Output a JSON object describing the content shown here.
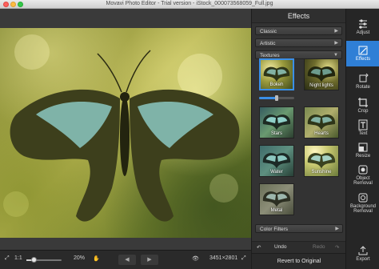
{
  "window": {
    "title": "Movavi Photo Editor - Trial version - iStock_000073568059_Full.jpg"
  },
  "bottombar": {
    "ratio_label": "1:1",
    "zoom": "20%",
    "zoom_fraction": 0.2,
    "dimensions": "3451×2801"
  },
  "panel": {
    "title": "Effects",
    "categories": [
      "Classic",
      "Artistic",
      "Textures"
    ],
    "color_filters": "Color Filters",
    "effects": [
      "Bokeh",
      "Night lights",
      "Stars",
      "Hearts",
      "Water",
      "Sunshine",
      "Metal"
    ],
    "selected_effect": "Bokeh",
    "intensity_fraction": 0.5,
    "undo": "Undo",
    "redo": "Redo",
    "revert": "Revert to Original",
    "accent": "#3a8fe8"
  },
  "tools": {
    "items": [
      {
        "label": "Adjust",
        "icon": "sliders-icon"
      },
      {
        "label": "Effects",
        "icon": "magic-wand-icon"
      },
      {
        "label": "Rotate",
        "icon": "rotate-icon"
      },
      {
        "label": "Crop",
        "icon": "crop-icon"
      },
      {
        "label": "Text",
        "icon": "text-icon"
      },
      {
        "label": "Resize",
        "icon": "resize-icon"
      },
      {
        "label": "Object Removal",
        "icon": "eraser-icon"
      },
      {
        "label": "Background Removal",
        "icon": "background-removal-icon"
      },
      {
        "label": "Export",
        "icon": "export-icon"
      }
    ],
    "active": "Effects"
  }
}
